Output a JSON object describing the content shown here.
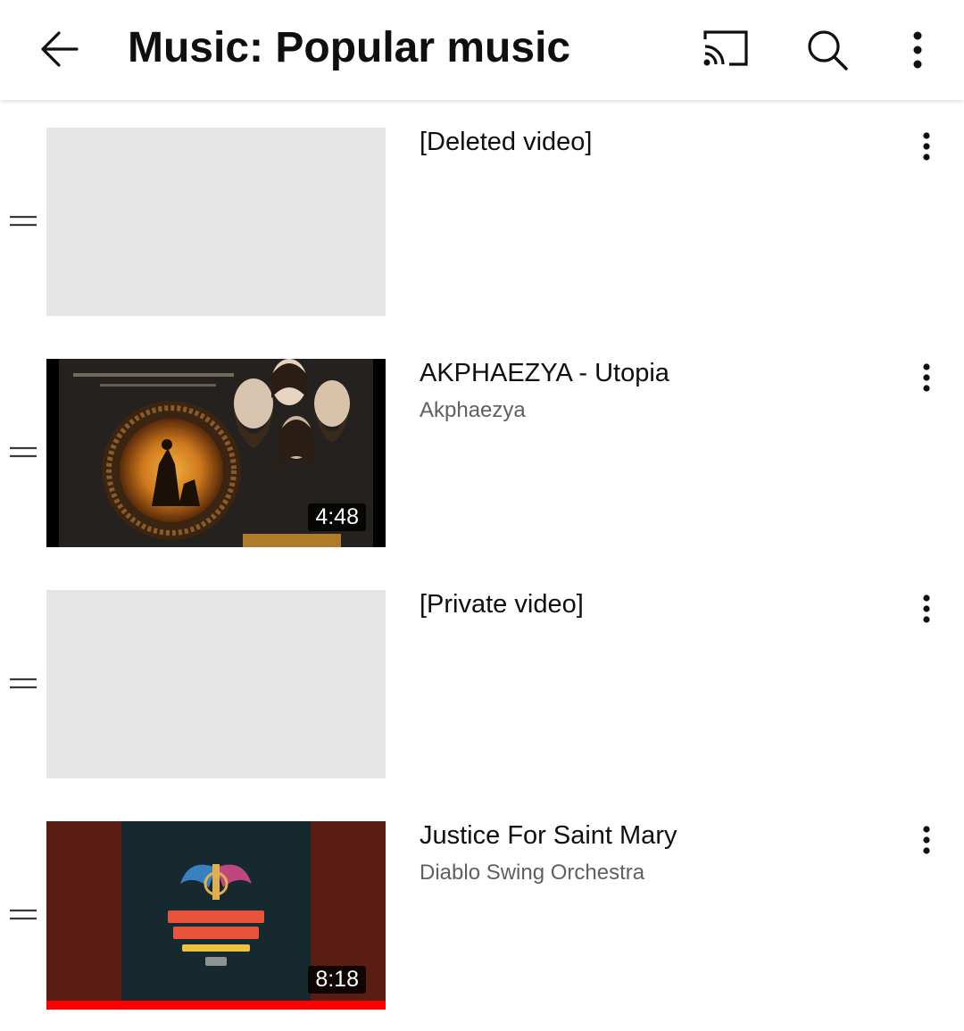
{
  "header": {
    "title": "Music: Popular music",
    "back_icon": "arrow-back-icon",
    "cast_icon": "cast-icon",
    "search_icon": "search-icon",
    "more_icon": "more-vert-icon"
  },
  "videos": [
    {
      "title": "[Deleted video]",
      "channel": "",
      "duration": "",
      "thumbnail": "placeholder"
    },
    {
      "title": "AKPHAEZYA - Utopia",
      "channel": "Akphaezya",
      "duration": "4:48",
      "thumbnail": "album-art-akphaezya"
    },
    {
      "title": "[Private video]",
      "channel": "",
      "duration": "",
      "thumbnail": "placeholder"
    },
    {
      "title": "Justice For Saint Mary",
      "channel": "Diablo Swing Orchestra",
      "duration": "8:18",
      "thumbnail": "album-art-diablo-swing-orchestra",
      "watch_progress": 1.0
    }
  ],
  "colors": {
    "progress_bar": "#ff0000",
    "placeholder": "#e5e5e5",
    "title_text": "#0f0f0f",
    "secondary_text": "#606060"
  }
}
